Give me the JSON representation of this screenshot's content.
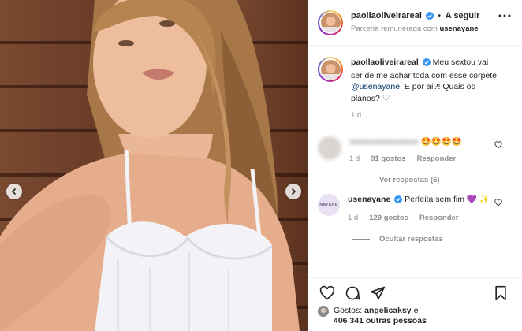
{
  "header": {
    "username": "paollaoliveirareal",
    "separator": "•",
    "follow_label": "A seguir",
    "partnership_prefix": "Parceria remunerada com",
    "partner": "usenayane"
  },
  "caption": {
    "username": "paollaoliveirareal",
    "text_before": " Meu sextou vai ser de me achar toda com esse corpete ",
    "mention": "@usenayane",
    "text_after": ". E por aí?! Quais os planos? ",
    "emoji": "♡",
    "time": "1 d"
  },
  "comments": [
    {
      "username": "xxxxxxxxxxxxxxx",
      "text": "🤩🤩🤩🤩",
      "time": "1 d",
      "likes": "91 gostos",
      "reply_label": "Responder",
      "view_replies": "Ver respostas (6)"
    },
    {
      "username": "usenayane",
      "avatar_text": "NAYANE",
      "text": " Perfeita sem fim 💜 ✨",
      "time": "1 d",
      "likes": "129 gostos",
      "reply_label": "Responder",
      "hide_replies": "Ocultar respostas"
    }
  ],
  "likes": {
    "prefix": "Gostos:",
    "user": "angelicaksy",
    "connector": "e",
    "others": "406 341 outras pessoas"
  },
  "colors": {
    "verified": "#3897f0",
    "link": "#00376b",
    "muted": "#8e8e8e"
  },
  "icons": [
    "verified-icon",
    "more-icon",
    "heart-icon",
    "comment-icon",
    "share-icon",
    "bookmark-icon",
    "chevron-left-icon",
    "chevron-right-icon"
  ]
}
